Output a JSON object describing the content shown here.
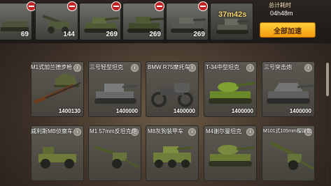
{
  "queue": {
    "slots": [
      {
        "count": "69"
      },
      {
        "count": "144"
      },
      {
        "count": "269"
      },
      {
        "count": "269"
      },
      {
        "count": "269"
      }
    ],
    "active": {
      "timer": "37m42s",
      "count": "269"
    },
    "total_label": "总计耗时",
    "total_value": "04h48m",
    "speedup_label": "全部加速"
  },
  "cards": [
    {
      "name": "M1式加兰德步枪",
      "price": "1400130"
    },
    {
      "name": "三号轻型坦克",
      "price": "1400000"
    },
    {
      "name": "BMW R75摩托车",
      "price": "1400000"
    },
    {
      "name": "T-34中型坦克",
      "price": "1400000"
    },
    {
      "name": "三号突击炮",
      "price": "1400000"
    },
    {
      "name": "威利斯MB侦察车",
      "price": ""
    },
    {
      "name": "M1 57mm反坦克炮",
      "price": ""
    },
    {
      "name": "M8灰狗装甲车",
      "price": ""
    },
    {
      "name": "M4谢尔曼坦克",
      "price": ""
    },
    {
      "name": "M101式105mm榴弹炮",
      "price": ""
    }
  ],
  "colors": {
    "accent": "#f29a0e",
    "remove": "#c02323",
    "timer": "#f5d76e"
  }
}
